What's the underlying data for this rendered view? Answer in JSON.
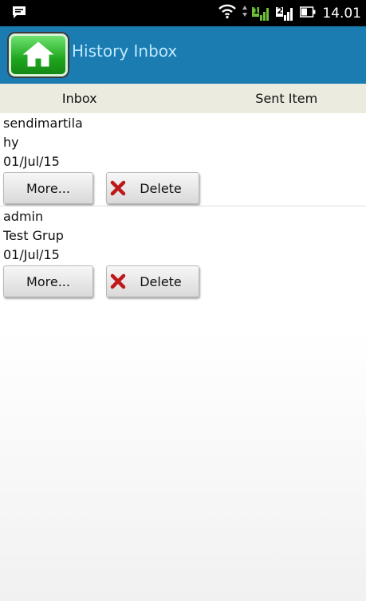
{
  "status_bar": {
    "time": "14.01",
    "icons": [
      "chat-notification-icon",
      "wifi-icon",
      "signal-sim1-icon",
      "signal-sim2-icon",
      "battery-icon"
    ],
    "sim1_label": "1",
    "sim2_label": "2"
  },
  "app_bar": {
    "title": "History Inbox",
    "home_icon": "home-icon",
    "color": "#1a7cb0"
  },
  "tabs": [
    {
      "label": "Inbox"
    },
    {
      "label": "Sent Item"
    }
  ],
  "messages": [
    {
      "sender": "sendimartila",
      "text": "hy",
      "date": "01/Jul/15",
      "more_label": "More...",
      "delete_label": "Delete"
    },
    {
      "sender": "admin",
      "text": "Test Grup",
      "date": "01/Jul/15",
      "more_label": "More...",
      "delete_label": "Delete"
    }
  ]
}
